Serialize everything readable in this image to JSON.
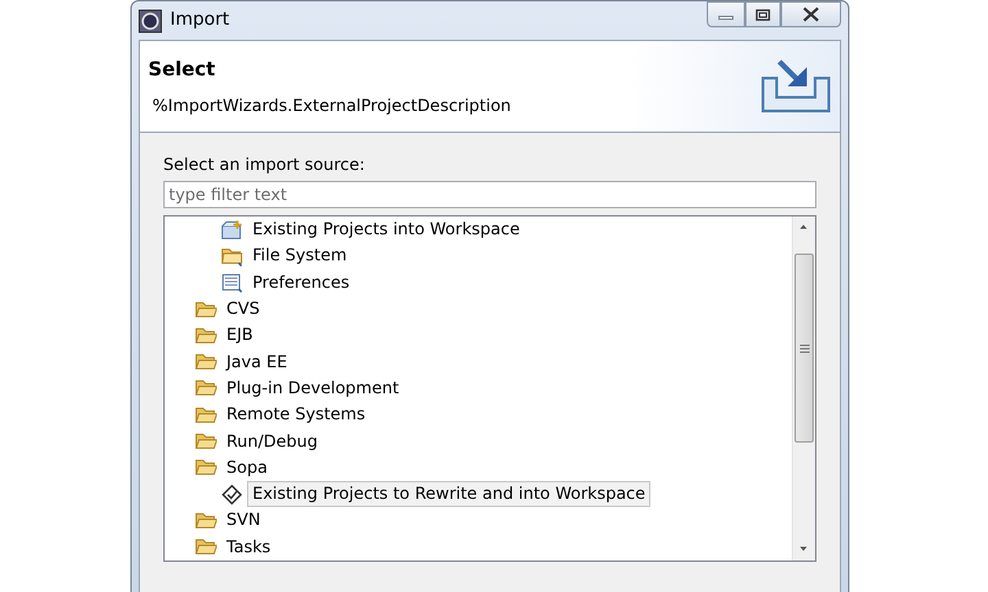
{
  "window": {
    "title": "Import"
  },
  "header": {
    "title": "Select",
    "description": "%ImportWizards.ExternalProjectDescription"
  },
  "source_label": "Select an import source:",
  "filter": {
    "placeholder": "type filter text"
  },
  "tree": [
    {
      "children": [
        {
          "label": "Existing Projects into Workspace",
          "kind": "project",
          "selected": false
        },
        {
          "label": "File System",
          "kind": "file-system",
          "selected": false
        },
        {
          "label": "Preferences",
          "kind": "preferences",
          "selected": false
        }
      ]
    },
    {
      "label": "CVS",
      "kind": "folder",
      "selected": false
    },
    {
      "label": "EJB",
      "kind": "folder",
      "selected": false
    },
    {
      "label": "Java EE",
      "kind": "folder",
      "selected": false
    },
    {
      "label": "Plug-in Development",
      "kind": "folder",
      "selected": false
    },
    {
      "label": "Remote Systems",
      "kind": "folder",
      "selected": false
    },
    {
      "label": "Run/Debug",
      "kind": "folder",
      "selected": false
    },
    {
      "label": "Sopa",
      "kind": "folder",
      "selected": false,
      "children": [
        {
          "label": "Existing Projects to Rewrite and into Workspace",
          "kind": "wizard",
          "selected": true
        }
      ]
    },
    {
      "label": "SVN",
      "kind": "folder",
      "selected": false
    },
    {
      "label": "Tasks",
      "kind": "folder",
      "selected": false
    }
  ]
}
